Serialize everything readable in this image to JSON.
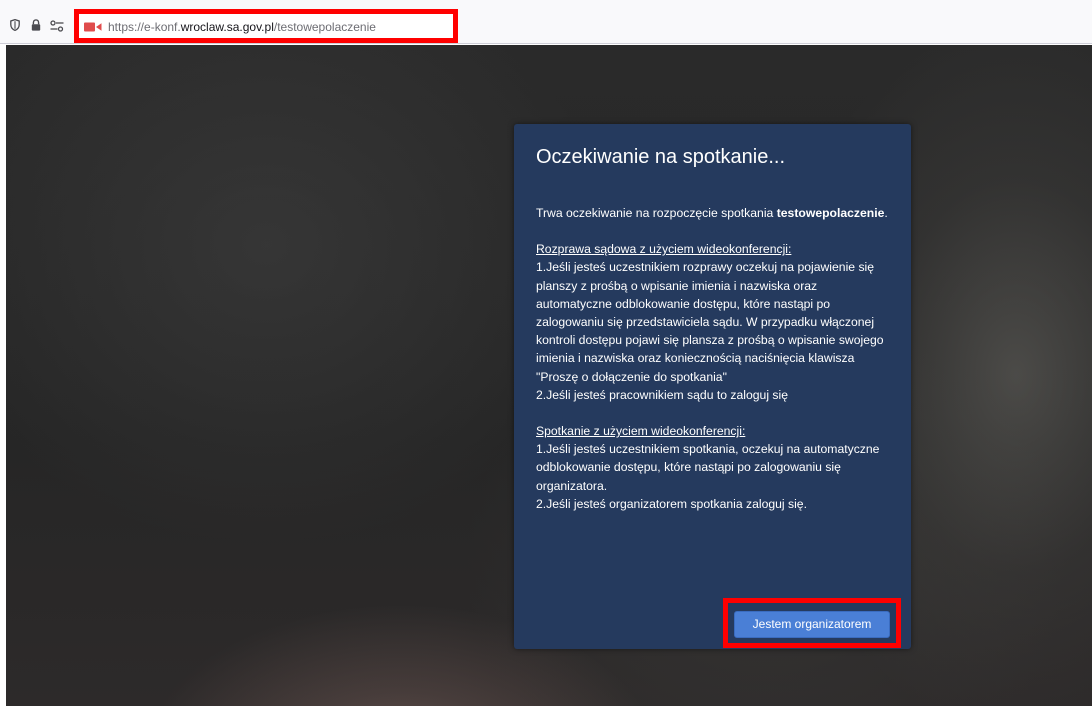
{
  "browser": {
    "url_prefix": "https://e-konf.",
    "url_host": "wroclaw.sa.gov.pl",
    "url_path": "/testowepolaczenie",
    "icons": [
      "shield-icon",
      "lock-icon",
      "permissions-icon",
      "camera-icon"
    ]
  },
  "dialog": {
    "title": "Oczekiwanie na spotkanie...",
    "intro": "Trwa oczekiwanie na rozpoczęcie spotkania",
    "meeting_name": "testowepolaczenie",
    "intro_end": ".",
    "court_heading": "Rozprawa sądowa z użyciem wideokonferencji:",
    "court_item1": "1.Jeśli jesteś uczestnikiem rozprawy oczekuj na pojawienie się planszy z prośbą o wpisanie imienia i nazwiska oraz automatyczne odblokowanie dostępu, które nastąpi po zalogowaniu się przedstawiciela sądu. W przypadku włączonej kontroli dostępu pojawi się plansza z prośbą o wpisanie swojego imienia i nazwiska oraz koniecznością naciśnięcia klawisza \"Proszę o dołączenie do spotkania\"",
    "court_item2": "2.Jeśli jesteś pracownikiem sądu to zaloguj się",
    "meeting_heading": "Spotkanie z użyciem wideokonferencji:",
    "meeting_item1": "1.Jeśli jesteś uczestnikiem spotkania, oczekuj na automatyczne odblokowanie dostępu, które nastąpi po zalogowaniu się organizatora.",
    "meeting_item2": "2.Jeśli jesteś organizatorem spotkania zaloguj się.",
    "organizer_button": "Jestem organizatorem"
  },
  "colors": {
    "dialog_bg": "#253a5e",
    "button_bg": "#4a7fd6",
    "highlight": "#ff0000"
  }
}
